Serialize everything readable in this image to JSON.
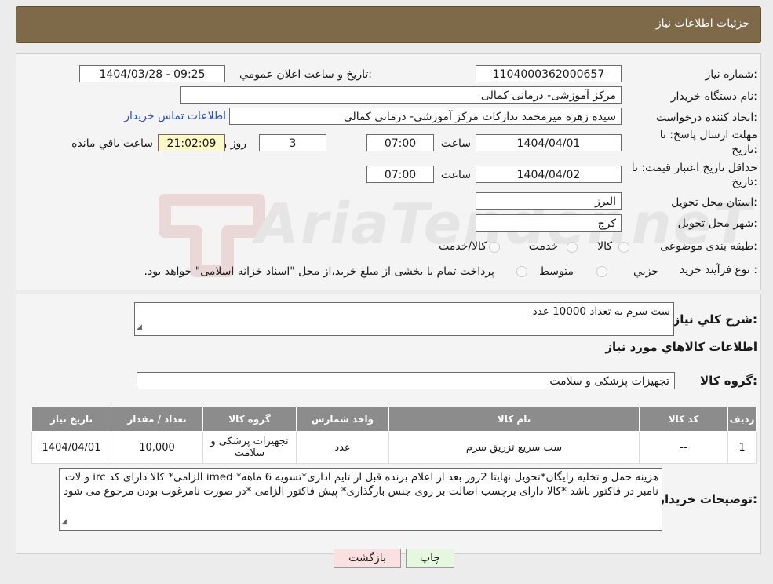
{
  "header": {
    "title": "جزئیات اطلاعات نیاز"
  },
  "form": {
    "need_number_label": "شماره نیاز:",
    "need_number": "1104000362000657",
    "announce_label": "تاریخ و ساعت اعلان عمومي:",
    "announce_value": "1404/03/28 - 09:25",
    "buyer_org_label": "نام دستگاه خريدار:",
    "buyer_org": "مرکز آموزشی- درمانی کمالی",
    "creator_label": "ايجاد کننده درخواست:",
    "creator": "سیده زهره میرمحمد تداركات مرکز آموزشی- درمانی کمالی",
    "contact_link": "اطلاعات تماس خريدار",
    "deadline_label_1": "مهلت ارسال پاسخ: تا",
    "deadline_label_2": "تاريخ:",
    "deadline_date": "1404/04/01",
    "time_label": "ساعت",
    "deadline_time": "07:00",
    "days_value": "3",
    "days_label": "روز و",
    "remaining_time": "21:02:09",
    "remaining_label": "ساعت باقي مانده",
    "validity_label_1": "حداقل تاريخ اعتبار قيمت: تا",
    "validity_label_2": "تاريخ:",
    "validity_date": "1404/04/02",
    "validity_time": "07:00",
    "province_label": "استان محل تحويل:",
    "province": "البرز",
    "city_label": "شهر محل تحويل:",
    "city": "کرج",
    "category_label": "طبقه بندی موضوعی:",
    "category_options": [
      "کالا",
      "خدمت",
      "کالا/خدمت"
    ],
    "process_label": "نوع فرآيند خريد :",
    "process_options": [
      "جزيي",
      "متوسط"
    ],
    "process_note": "پرداخت تمام يا بخشی از مبلغ خريد،از محل \"اسناد خزانه اسلامی\" خواهد بود."
  },
  "summary": {
    "desc_label": "شرح کلي نياز:",
    "desc_value": "ست سرم به تعداد 10000 عدد",
    "goods_info_title": "اطلاعات کالاهاي مورد نياز",
    "group_label": "گروه کالا:",
    "group_value": "تجهیزات پزشکی و سلامت"
  },
  "table": {
    "headers": [
      "رديف",
      "کد کالا",
      "نام کالا",
      "واحد شمارش",
      "گروه کالا",
      "تعداد / مقدار",
      "تاريخ نياز"
    ],
    "rows": [
      [
        "1",
        "--",
        "ست سریع تزریق سرم",
        "عدد",
        "تجهیزات پزشکی و سلامت",
        "10,000",
        "1404/04/01"
      ]
    ]
  },
  "notes": {
    "label": "توضيحات خريدار:",
    "text": "هزینه حمل و تخلیه رایگان*تحویل نهایتا 2روز بعد از اعلام برنده قبل از تایم اداری*تسویه 6 ماهه* imed الزامی* کالا دارای کد irc و لات نامبر در فاکتور باشد *کالا دارای برچسب اصالت بر روی جنس بارگذاری* پیش فاکتور الزامی *در صورت نامرغوب بودن مرجوع می شود"
  },
  "buttons": {
    "print": "چاپ",
    "back": "بازگشت"
  },
  "watermark": {
    "text": "AriaTender.neT"
  },
  "colors": {
    "header_bg": "#7e6a48",
    "link": "#2a4fc4",
    "back_btn": "#fbe0e0",
    "print_btn": "#e5f7df"
  }
}
